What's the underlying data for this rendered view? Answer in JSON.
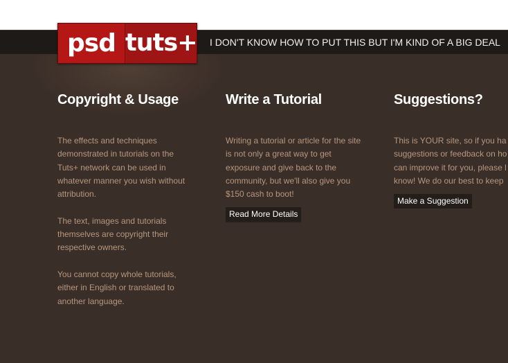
{
  "header": {
    "logo": {
      "left": "psd",
      "right": "tuts+"
    },
    "tagline": "I DON'T KNOW HOW TO PUT THIS BUT I'M KIND OF A BIG DEAL"
  },
  "colors": {
    "background": "#3a2e28",
    "top_bar": "#1e1a17",
    "logo_red": "#b51717",
    "body_text": "#b7977f",
    "heading_text": "#ffffff",
    "button_bg": "#241e1a"
  },
  "columns": [
    {
      "heading": "Copyright & Usage",
      "paragraphs": [
        "The effects and techniques demonstrated in tutorials on the Tuts+ network can be used in whatever manner you wish without attribution.",
        "The text, images and tutorials themselves are copyright their respective owners.",
        "You cannot copy whole tutorials, either in English or translated to another language."
      ]
    },
    {
      "heading": "Write a Tutorial",
      "paragraphs": [
        "Writing a tutorial or article for the site is not only a great way to get exposure and give back to the community, but we'll also give you $150 cash to boot!"
      ],
      "button": "Read More Details"
    },
    {
      "heading": "Suggestions?",
      "lines": [
        "This is YOUR site, so if you ha",
        "suggestions or feedback on ho",
        "can improve it for you, please l",
        "know! We do our best to keep"
      ],
      "button": "Make a Suggestion"
    }
  ]
}
